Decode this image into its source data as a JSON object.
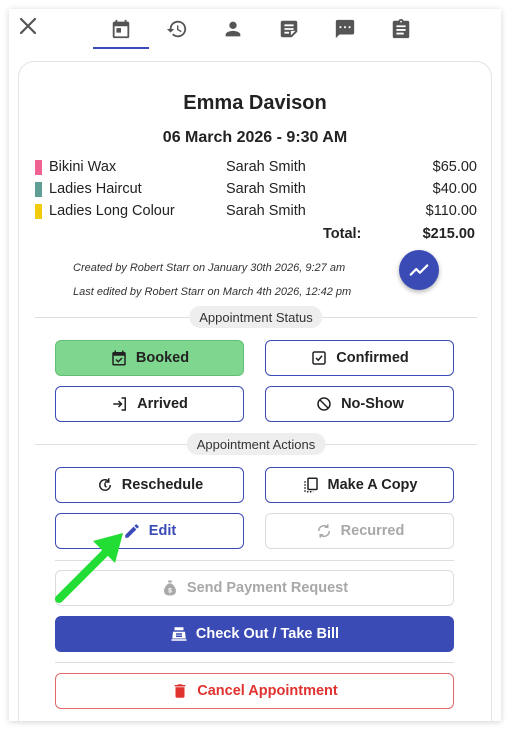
{
  "tabs": [
    {
      "name": "tab-calendar",
      "icon": "calendar-icon",
      "active": true
    },
    {
      "name": "tab-history",
      "icon": "history-icon",
      "active": false
    },
    {
      "name": "tab-client",
      "icon": "person-icon",
      "active": false
    },
    {
      "name": "tab-notes",
      "icon": "note-icon",
      "active": false
    },
    {
      "name": "tab-messages",
      "icon": "message-icon",
      "active": false
    },
    {
      "name": "tab-forms",
      "icon": "clipboard-icon",
      "active": false
    }
  ],
  "appointment": {
    "client": "Emma Davison",
    "datetime": "06 March 2026 - 9:30 AM",
    "services": [
      {
        "name": "Bikini Wax",
        "staff": "Sarah Smith",
        "price": "$65.00",
        "color": "#f06292"
      },
      {
        "name": "Ladies Haircut",
        "staff": "Sarah Smith",
        "price": "$40.00",
        "color": "#5f9e94"
      },
      {
        "name": "Ladies Long Colour",
        "staff": "Sarah Smith",
        "price": "$110.00",
        "color": "#f2cc0c"
      }
    ],
    "total_label": "Total:",
    "total_value": "$215.00",
    "created": "Created by Robert Starr on January 30th 2026, 9:27 am",
    "edited": "Last edited by Robert Starr on March 4th 2026, 12:42 pm"
  },
  "status": {
    "heading": "Appointment Status",
    "booked": "Booked",
    "confirmed": "Confirmed",
    "arrived": "Arrived",
    "no_show": "No-Show"
  },
  "actions": {
    "heading": "Appointment Actions",
    "reschedule": "Reschedule",
    "make_copy": "Make A Copy",
    "edit": "Edit",
    "recurred": "Recurred",
    "send_payment": "Send Payment Request",
    "checkout": "Check Out / Take Bill",
    "cancel": "Cancel Appointment"
  },
  "colors": {
    "accent": "#3a4bb5",
    "booked": "#7fd68e",
    "danger": "#e0322f",
    "annotation_arrow": "#22dd33"
  }
}
